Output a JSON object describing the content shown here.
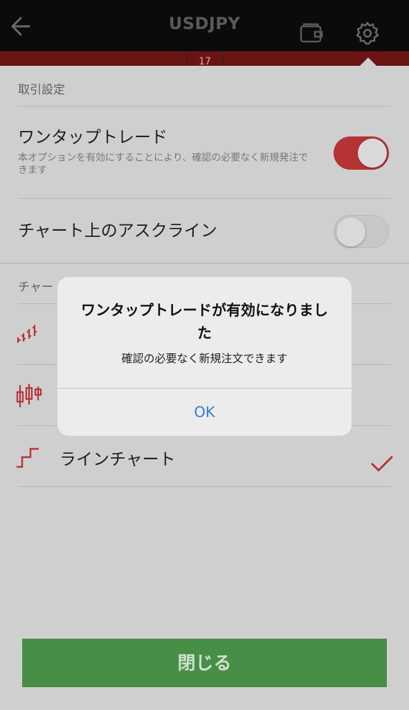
{
  "header": {
    "title": "USDJPY",
    "strip_value": "17"
  },
  "trade_settings": {
    "section_label": "取引設定",
    "one_tap": {
      "title": "ワンタップトレード",
      "description": "本オプションを有効にすることにより、確認の必要なく新規発注できます",
      "enabled": true
    },
    "ask_line": {
      "title": "チャート上のアスクライン",
      "enabled": false
    }
  },
  "chart_settings": {
    "section_label": "チャー",
    "items": [
      {
        "label": "",
        "icon": "bar-chart-icon",
        "selected": false
      },
      {
        "label": "",
        "icon": "candlestick-chart-icon",
        "selected": true
      },
      {
        "label": "ラインチャート",
        "icon": "line-chart-icon",
        "selected": false
      }
    ]
  },
  "footer": {
    "close_label": "閉じる"
  },
  "alert": {
    "title": "ワンタップトレードが有効になりました",
    "message": "確認の必要なく新規注文できます",
    "ok_label": "OK"
  },
  "colors": {
    "accent_red": "#b53333",
    "close_green": "#478e47",
    "ok_blue": "#3a7be0"
  }
}
